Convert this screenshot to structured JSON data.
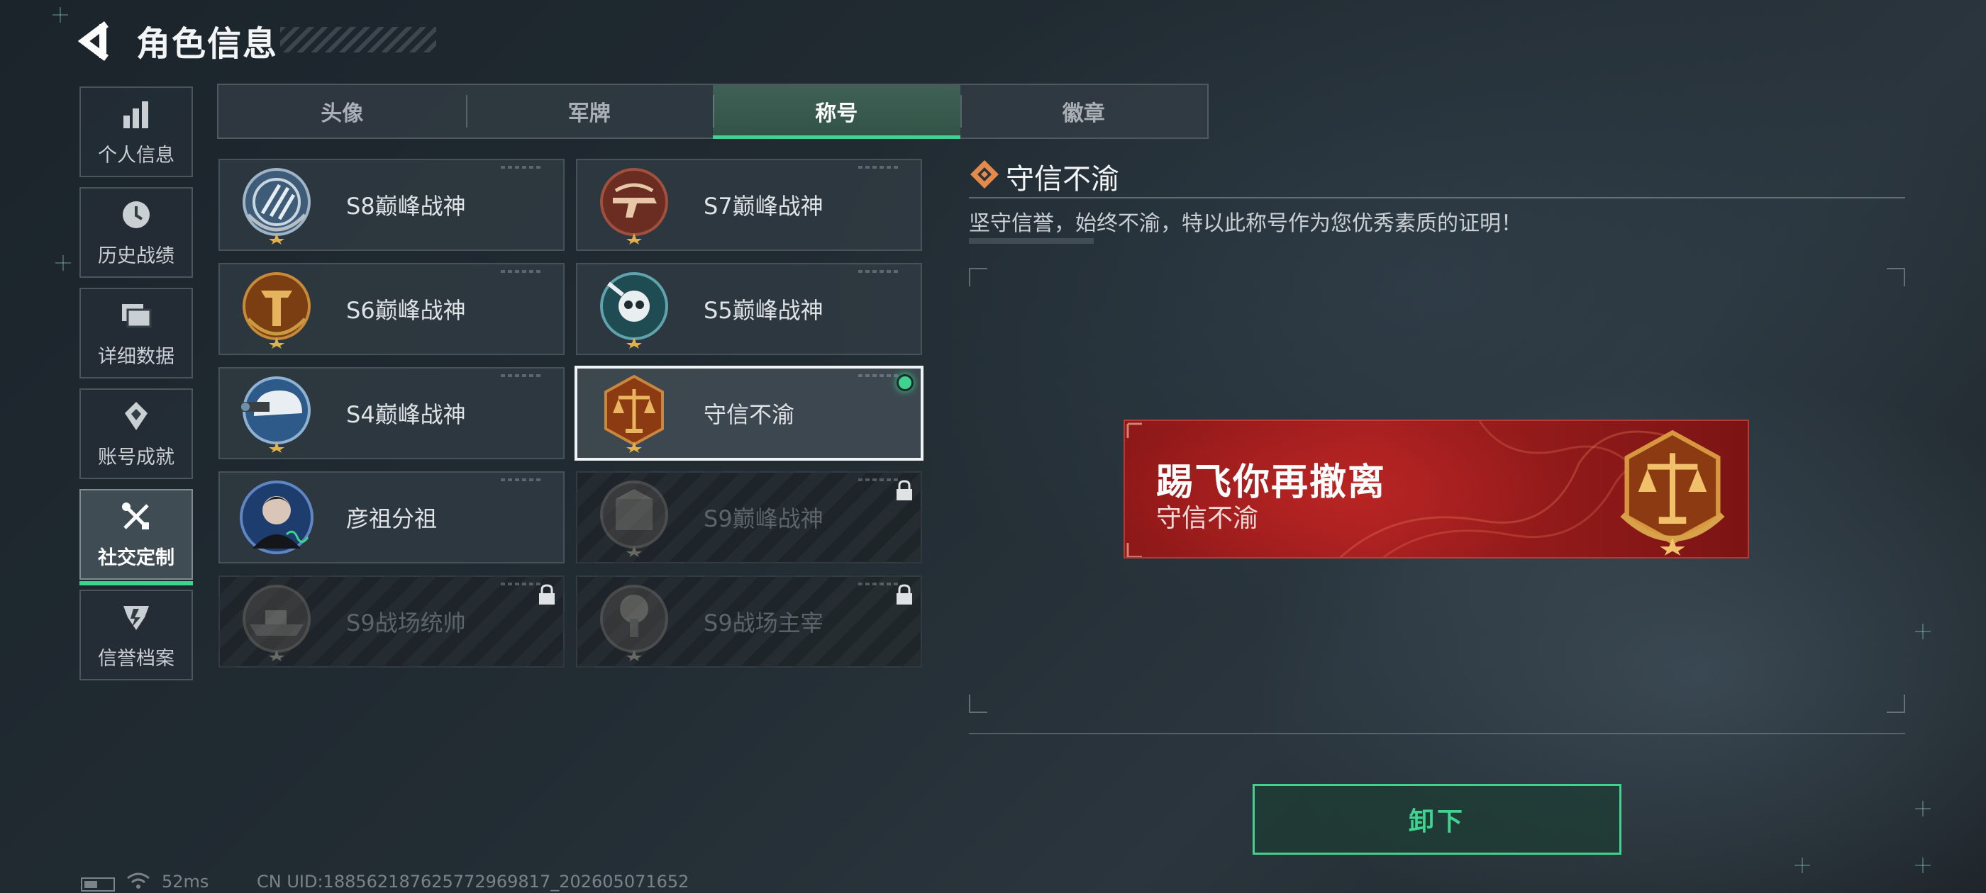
{
  "header": {
    "title": "角色信息"
  },
  "nav": {
    "items": [
      {
        "label": "个人信息",
        "icon": "bar-chart-icon"
      },
      {
        "label": "历史战绩",
        "icon": "clock-icon"
      },
      {
        "label": "详细数据",
        "icon": "folders-icon"
      },
      {
        "label": "账号成就",
        "icon": "achievement-icon"
      },
      {
        "label": "社交定制",
        "icon": "tools-icon",
        "active": true
      },
      {
        "label": "信誉档案",
        "icon": "shield-icon"
      }
    ]
  },
  "tabs": [
    {
      "label": "头像"
    },
    {
      "label": "军牌"
    },
    {
      "label": "称号",
      "active": true
    },
    {
      "label": "徽章"
    }
  ],
  "titles": [
    {
      "label": "S8巅峰战神",
      "state": "unlocked"
    },
    {
      "label": "S7巅峰战神",
      "state": "unlocked"
    },
    {
      "label": "S6巅峰战神",
      "state": "unlocked"
    },
    {
      "label": "S5巅峰战神",
      "state": "unlocked"
    },
    {
      "label": "S4巅峰战神",
      "state": "unlocked"
    },
    {
      "label": "守信不渝",
      "state": "selected-equipped"
    },
    {
      "label": "彦祖分祖",
      "state": "unlocked"
    },
    {
      "label": "S9巅峰战神",
      "state": "locked"
    },
    {
      "label": "S9战场统帅",
      "state": "locked"
    },
    {
      "label": "S9战场主宰",
      "state": "locked"
    }
  ],
  "detail": {
    "name": "守信不渝",
    "description": "坚守信誉，始终不渝，特以此称号作为您优秀素质的证明！"
  },
  "preview": {
    "player_name": "踢飞你再撤离",
    "title": "守信不渝"
  },
  "actions": {
    "unequip_label": "卸下"
  },
  "status": {
    "ping": "52ms",
    "uid": "CN UID:18856218762577296981​7_202605071652"
  },
  "colors": {
    "accent": "#3ed38e",
    "banner_red": "#a41f1f",
    "background": "#222c33"
  }
}
